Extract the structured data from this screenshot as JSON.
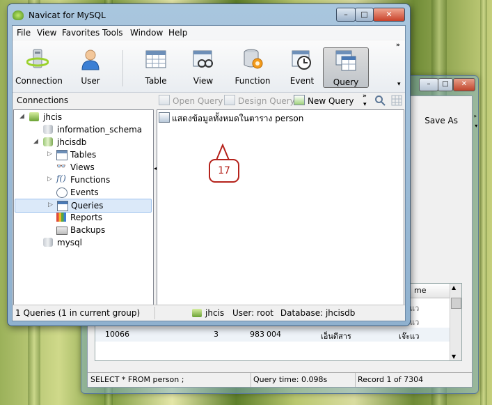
{
  "main_window": {
    "title": "Navicat for MySQL",
    "menu": [
      "File",
      "View",
      "Favorites",
      "Tools",
      "Window",
      "Help"
    ],
    "toolbar": {
      "connection": "Connection",
      "user": "User",
      "table": "Table",
      "view": "View",
      "function": "Function",
      "event": "Event",
      "query": "Query"
    },
    "connections_label": "Connections",
    "object_toolbar": {
      "open_query": "Open Query",
      "design_query": "Design Query",
      "new_query": "New Query"
    },
    "tree": [
      {
        "label": "jhcis",
        "icon": "connection-icon"
      },
      {
        "label": "information_schema",
        "icon": "database-icon"
      },
      {
        "label": "jhcisdb",
        "icon": "database-open-icon"
      },
      {
        "label": "Tables",
        "icon": "table-icon"
      },
      {
        "label": "Views",
        "icon": "view-icon"
      },
      {
        "label": "Functions",
        "icon": "function-icon"
      },
      {
        "label": "Events",
        "icon": "event-icon"
      },
      {
        "label": "Queries",
        "icon": "query-icon"
      },
      {
        "label": "Reports",
        "icon": "report-icon"
      },
      {
        "label": "Backups",
        "icon": "backup-icon"
      },
      {
        "label": "mysql",
        "icon": "database-icon"
      }
    ],
    "query_item": "แสดงข้อมูลทั้งหมดในตาราง person",
    "callout_number": "17",
    "status": {
      "count": "1 Queries (1 in current group)",
      "connection": "jhcis",
      "user": "User: root",
      "database": "Database: jhcisdb"
    }
  },
  "back_window": {
    "save_as": "Save As",
    "grid_header": "me",
    "grid_row": {
      "c1": "10066",
      "c2": "3",
      "c3": "983",
      "c4": "004",
      "c5": "เอ็นดีสาร",
      "c6": "เจ๊ะแว"
    },
    "partial_cells": [
      "แว",
      "แว"
    ],
    "status": {
      "sql": "SELECT * FROM person ;",
      "time": "Query time: 0.098s",
      "record": "Record 1 of 7304"
    }
  }
}
